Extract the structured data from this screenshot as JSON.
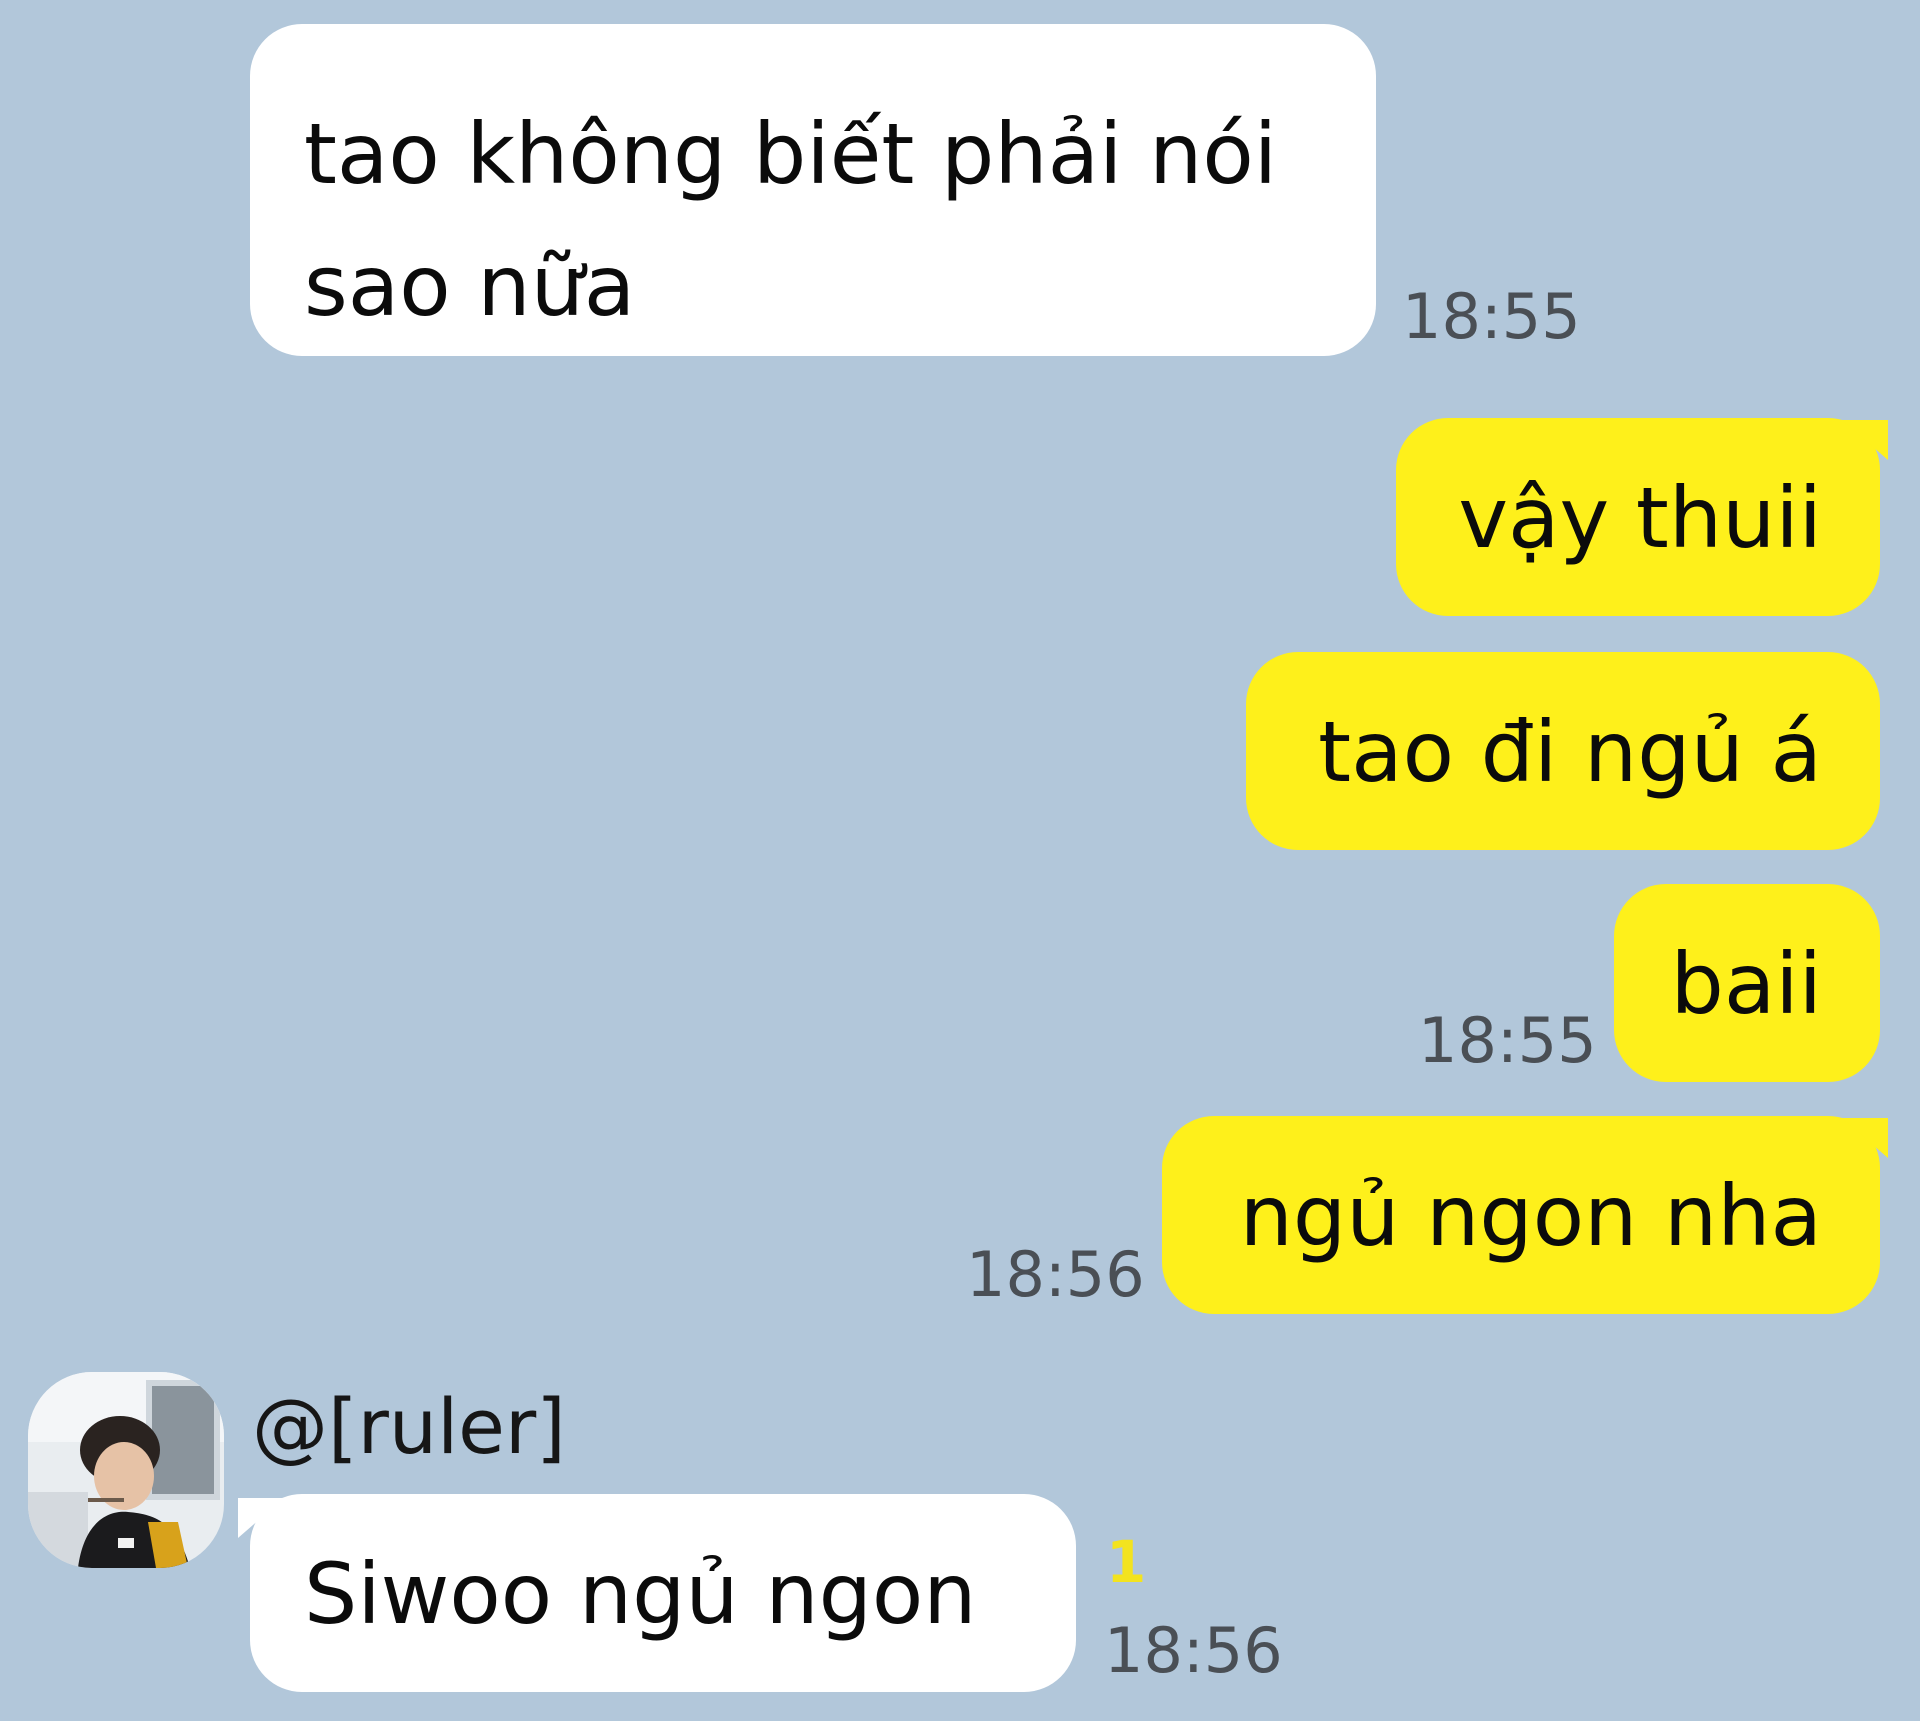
{
  "colors": {
    "background": "#b2c7da",
    "incoming_bubble": "#ffffff",
    "outgoing_bubble": "#fef01b",
    "unread_count": "#f3e31f",
    "timestamp": "#4a4f55"
  },
  "messages": [
    {
      "direction": "incoming",
      "lines": [
        "tao không biết phải nói",
        "sao nữa"
      ],
      "time": "18:55"
    },
    {
      "direction": "outgoing",
      "text": "vậy thuii"
    },
    {
      "direction": "outgoing",
      "text": "tao đi ngủ á"
    },
    {
      "direction": "outgoing",
      "text": "baii",
      "time": "18:55"
    },
    {
      "direction": "outgoing",
      "text": "ngủ ngon nha",
      "time": "18:56"
    }
  ],
  "last_message": {
    "sender_name": "@[ruler]",
    "avatar_icon": "profile-photo",
    "text": "Siwoo ngủ ngon",
    "unread_count": "1",
    "time": "18:56"
  }
}
